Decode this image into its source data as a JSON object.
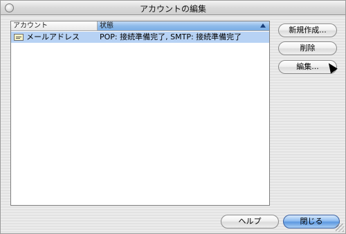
{
  "window": {
    "title": "アカウントの編集"
  },
  "table": {
    "headers": {
      "account": "アカウント",
      "status": "状態"
    },
    "rows": [
      {
        "account": "メールアドレス",
        "status": "POP: 接続準備完了, SMTP: 接続準備完了"
      }
    ]
  },
  "buttons": {
    "new": "新規作成...",
    "delete": "削除",
    "edit": "編集...",
    "help": "ヘルプ",
    "close": "閉じる"
  },
  "colors": {
    "selected_row": "#b7d2f4",
    "sorted_header": "#8fbbea",
    "primary_button": "#5c98e0"
  }
}
